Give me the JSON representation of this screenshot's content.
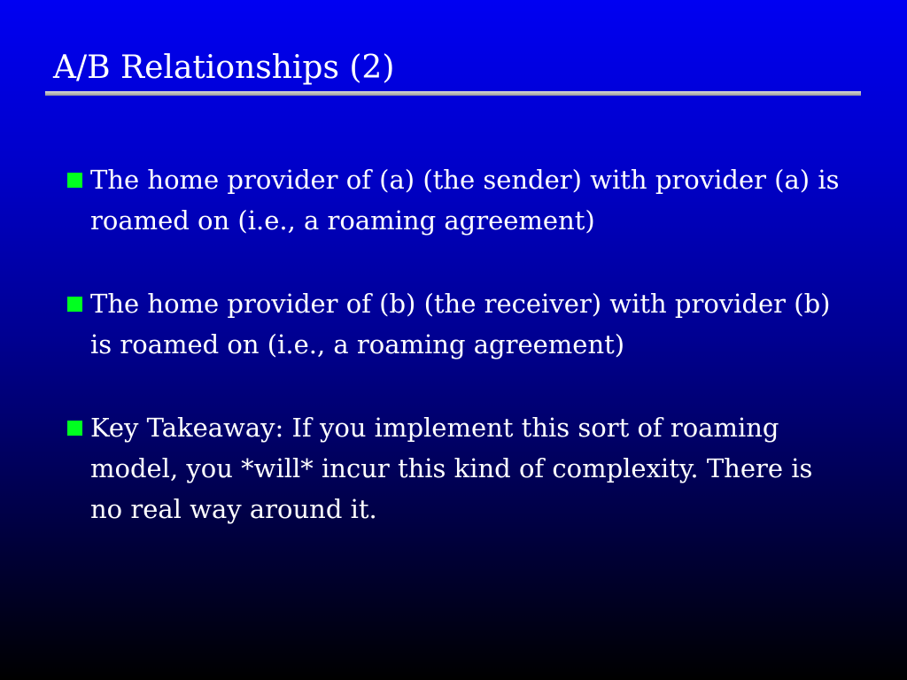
{
  "slide": {
    "title": "A/B Relationships (2)",
    "bullets": [
      {
        "text": "The home provider of (a) (the sender) with provider (a) is roamed on (i.e., a roaming agreement)"
      },
      {
        "text": "The home provider of (b) (the receiver) with provider (b) is roamed on (i.e., a roaming agreement)"
      },
      {
        "text": "Key Takeaway: If you implement this sort of roaming model, you *will* incur this kind of complexity. There is no real way around it."
      }
    ]
  },
  "colors": {
    "background_top": "#0000f2",
    "background_bottom": "#000000",
    "bullet_marker": "#00ff20",
    "text": "#ffffff",
    "title_rule": "#c0c0c0"
  },
  "icons": {
    "bullet": "square-bullet-icon"
  }
}
